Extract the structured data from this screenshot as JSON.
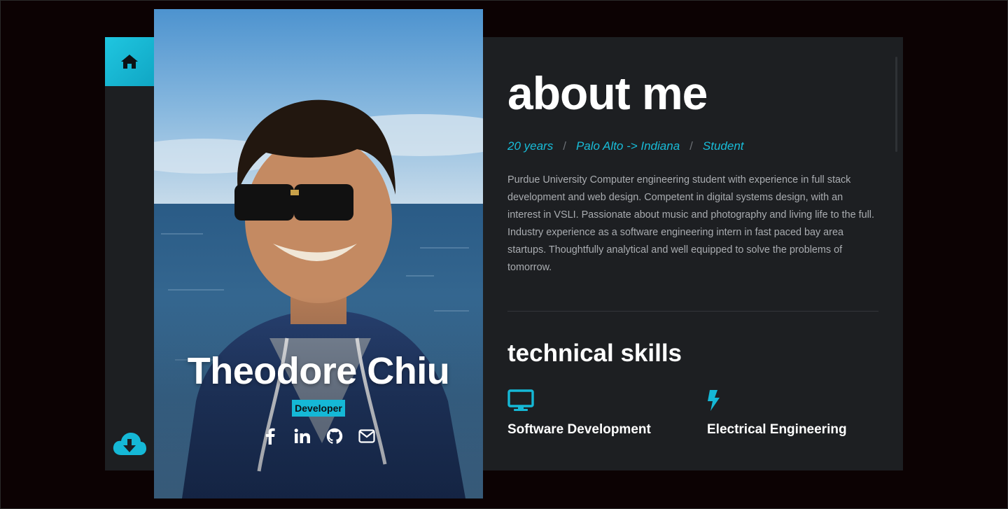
{
  "nav": {
    "home_icon": "home-icon",
    "download_icon": "cloud-download-icon",
    "accent": "#15b8d6"
  },
  "profile": {
    "name": "Theodore Chiu",
    "role": "Developer",
    "socials": [
      {
        "icon": "facebook-icon"
      },
      {
        "icon": "linkedin-icon"
      },
      {
        "icon": "github-icon"
      },
      {
        "icon": "envelope-icon"
      }
    ]
  },
  "about": {
    "title": "about me",
    "meta": [
      "20 years",
      "Palo Alto -> Indiana",
      "Student"
    ],
    "separator": "/",
    "bio": "Purdue University Computer engineering student with experience in full stack development and web design. Competent in digital systems design, with an interest in VSLI. Passionate about music and photography and living life to the full. Industry experience as a software engineering intern in fast paced bay area startups. Thoughtfully analytical and well equipped to solve the problems of tomorrow."
  },
  "skills": {
    "title": "technical skills",
    "items": [
      {
        "label": "Software Development",
        "icon": "desktop-icon"
      },
      {
        "label": "Electrical Engineering",
        "icon": "bolt-icon"
      }
    ]
  },
  "colors": {
    "accent": "#15b8d6",
    "panel": "#1d1f22",
    "background": "#0c0203"
  }
}
